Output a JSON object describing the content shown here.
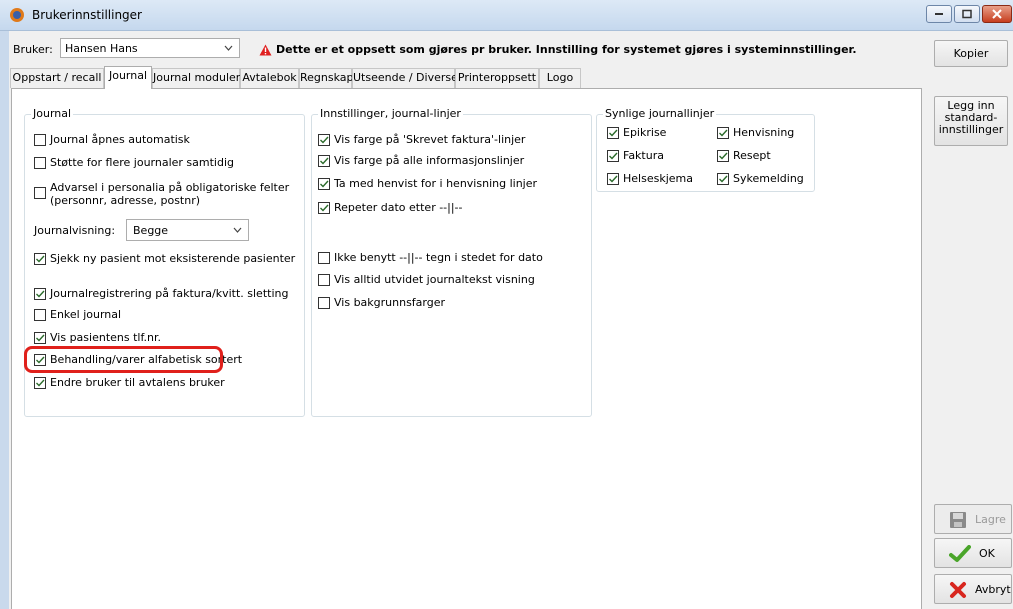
{
  "window": {
    "title": "Brukerinnstillinger"
  },
  "bruker": {
    "label": "Bruker:",
    "selected": "Hansen Hans"
  },
  "warning": {
    "text": "Dette er et oppsett som gjøres pr bruker. Innstilling for systemet gjøres i systeminnstillinger."
  },
  "tabs": [
    {
      "label": "Oppstart / recall"
    },
    {
      "label": "Journal"
    },
    {
      "label": "Journal moduler"
    },
    {
      "label": "Avtalebok"
    },
    {
      "label": "Regnskap"
    },
    {
      "label": "Utseende / Diverse"
    },
    {
      "label": "Printeroppsett"
    },
    {
      "label": "Logo"
    }
  ],
  "journal": {
    "title": "Journal",
    "items": [
      {
        "label": "Journal åpnes automatisk",
        "checked": false
      },
      {
        "label": "Støtte for flere journaler samtidig",
        "checked": false
      },
      {
        "label": "Advarsel i personalia på obligatoriske  felter\n(personnr, adresse, postnr)",
        "checked": false
      },
      {
        "label": "Sjekk ny pasient mot eksisterende pasienter",
        "checked": true
      },
      {
        "label": "Journalregistrering på faktura/kvitt. sletting",
        "checked": true
      },
      {
        "label": "Enkel journal",
        "checked": false
      },
      {
        "label": "Vis pasientens tlf.nr.",
        "checked": true
      },
      {
        "label": "Behandling/varer alfabetisk sortert",
        "checked": true
      },
      {
        "label": "Endre bruker til avtalens bruker",
        "checked": true
      }
    ],
    "journalvisning": {
      "label": "Journalvisning:",
      "selected": "Begge"
    }
  },
  "linjer": {
    "title": "Innstillinger, journal-linjer",
    "items": [
      {
        "label": "Vis farge på 'Skrevet faktura'-linjer",
        "checked": true
      },
      {
        "label": "Vis farge på alle informasjonslinjer",
        "checked": true
      },
      {
        "label": "Ta med henvist for i henvisning linjer",
        "checked": true
      },
      {
        "label": "Repeter dato etter --||--",
        "checked": true
      },
      {
        "label": "Ikke benytt --||-- tegn i stedet for dato",
        "checked": false
      },
      {
        "label": "Vis alltid utvidet journaltekst visning",
        "checked": false
      },
      {
        "label": "Vis bakgrunnsfarger",
        "checked": false
      }
    ]
  },
  "synlige": {
    "title": "Synlige journallinjer",
    "items": [
      {
        "label": "Epikrise",
        "checked": true
      },
      {
        "label": "Henvisning",
        "checked": true
      },
      {
        "label": "Faktura",
        "checked": true
      },
      {
        "label": "Resept",
        "checked": true
      },
      {
        "label": "Helseskjema",
        "checked": true
      },
      {
        "label": "Sykemelding",
        "checked": true
      }
    ]
  },
  "buttons": {
    "kopier": "Kopier",
    "legg_inn": "Legg inn\nstandard-\ninnstillinger",
    "lagre": "Lagre",
    "ok": "OK",
    "avbryt": "Avbryt"
  },
  "colors": {
    "highlight": "#e0201b",
    "check": "#2a6a2a",
    "warning": "#e02020"
  }
}
